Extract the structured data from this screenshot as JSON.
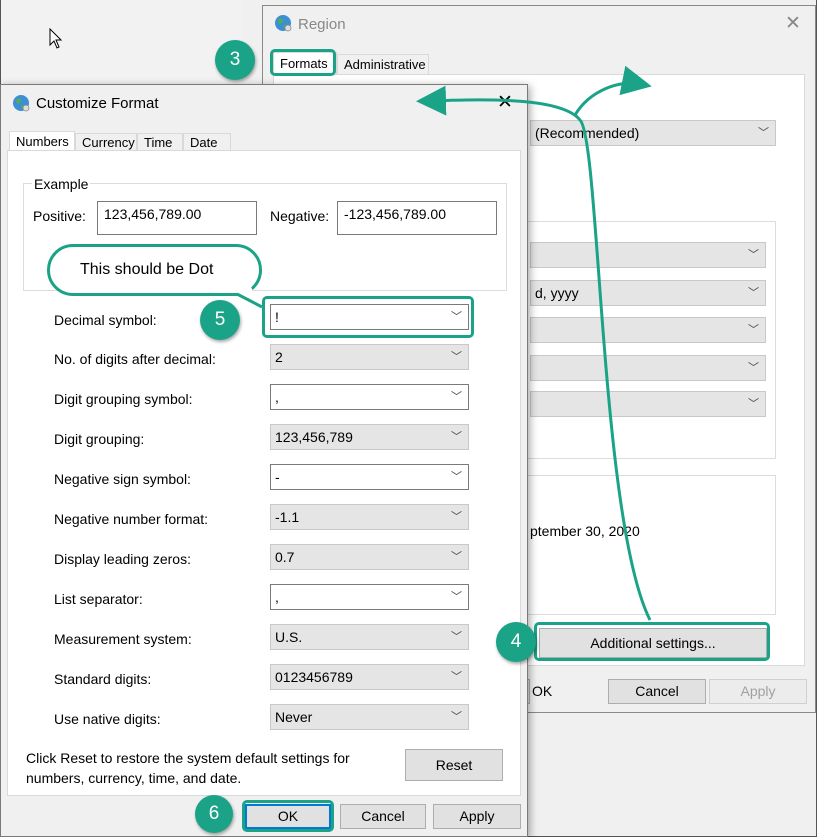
{
  "region": {
    "title": "Region",
    "tabs": [
      "Formats",
      "Administrative"
    ],
    "format_partial": "(Recommended)",
    "date_partial": "d, yyyy",
    "example_partial": "ptember 30, 2020",
    "additional_settings": "Additional settings...",
    "ok": "OK",
    "cancel": "Cancel",
    "apply": "Apply"
  },
  "dialog": {
    "title": "Customize Format",
    "tabs": [
      "Numbers",
      "Currency",
      "Time",
      "Date"
    ],
    "example_label": "Example",
    "positive_label": "Positive:",
    "positive_value": "123,456,789.00",
    "negative_label": "Negative:",
    "negative_value": "-123,456,789.00",
    "settings": [
      {
        "label": "Decimal symbol:",
        "value": "!"
      },
      {
        "label": "No. of digits after decimal:",
        "value": "2"
      },
      {
        "label": "Digit grouping symbol:",
        "value": ","
      },
      {
        "label": "Digit grouping:",
        "value": "123,456,789"
      },
      {
        "label": "Negative sign symbol:",
        "value": "-"
      },
      {
        "label": "Negative number format:",
        "value": "-1.1"
      },
      {
        "label": "Display leading zeros:",
        "value": "0.7"
      },
      {
        "label": "List separator:",
        "value": ","
      },
      {
        "label": "Measurement system:",
        "value": "U.S."
      },
      {
        "label": "Standard digits:",
        "value": "0123456789"
      },
      {
        "label": "Use native digits:",
        "value": "Never"
      }
    ],
    "reset_note": "Click Reset to restore the system default settings for numbers, currency, time, and date.",
    "reset": "Reset",
    "ok": "OK",
    "cancel": "Cancel",
    "apply": "Apply"
  },
  "annotations": {
    "step3": "3",
    "step4": "4",
    "step5": "5",
    "step6": "6",
    "callout": "This should be Dot"
  },
  "colors": {
    "accent": "#1aa387",
    "focus": "#0078d7"
  }
}
